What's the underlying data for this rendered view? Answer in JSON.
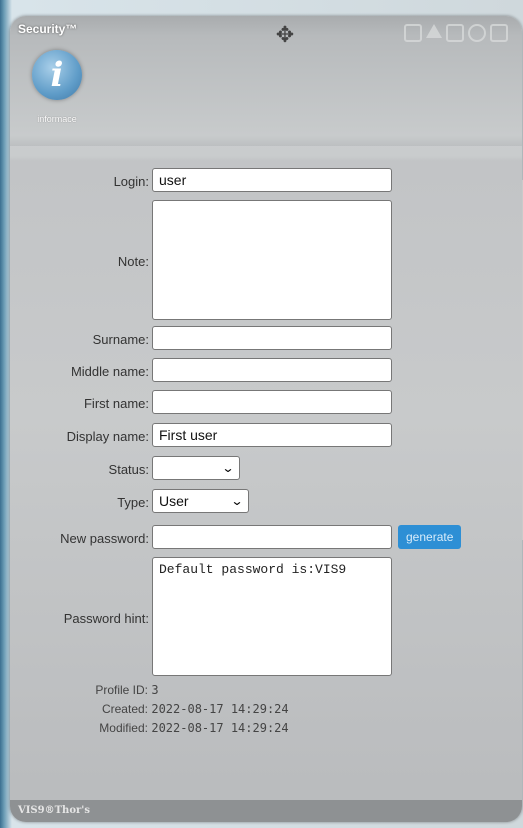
{
  "window": {
    "title": "Security™",
    "info_label": "informace",
    "footer": "VIS9®Thor's"
  },
  "form": {
    "login": {
      "label": "Login:",
      "value": "user"
    },
    "note": {
      "label": "Note:",
      "value": ""
    },
    "surname": {
      "label": "Surname:",
      "value": ""
    },
    "middle_name": {
      "label": "Middle name:",
      "value": ""
    },
    "first_name": {
      "label": "First name:",
      "value": ""
    },
    "display_name": {
      "label": "Display name:",
      "value": "First user"
    },
    "status": {
      "label": "Status:",
      "value": ""
    },
    "type": {
      "label": "Type:",
      "value": "User"
    },
    "new_password": {
      "label": "New password:",
      "value": ""
    },
    "generate_label": "generate",
    "password_hint": {
      "label": "Password hint:",
      "value": "Default password is:VIS9"
    }
  },
  "meta": {
    "profile_id": {
      "label": "Profile ID:",
      "value": "3"
    },
    "created": {
      "label": "Created:",
      "value": "2022-08-17 14:29:24"
    },
    "modified": {
      "label": "Modified:",
      "value": "2022-08-17 14:29:24"
    }
  },
  "colors": {
    "accent": "#2d8fd5",
    "info_icon": "#5f9cc8"
  }
}
